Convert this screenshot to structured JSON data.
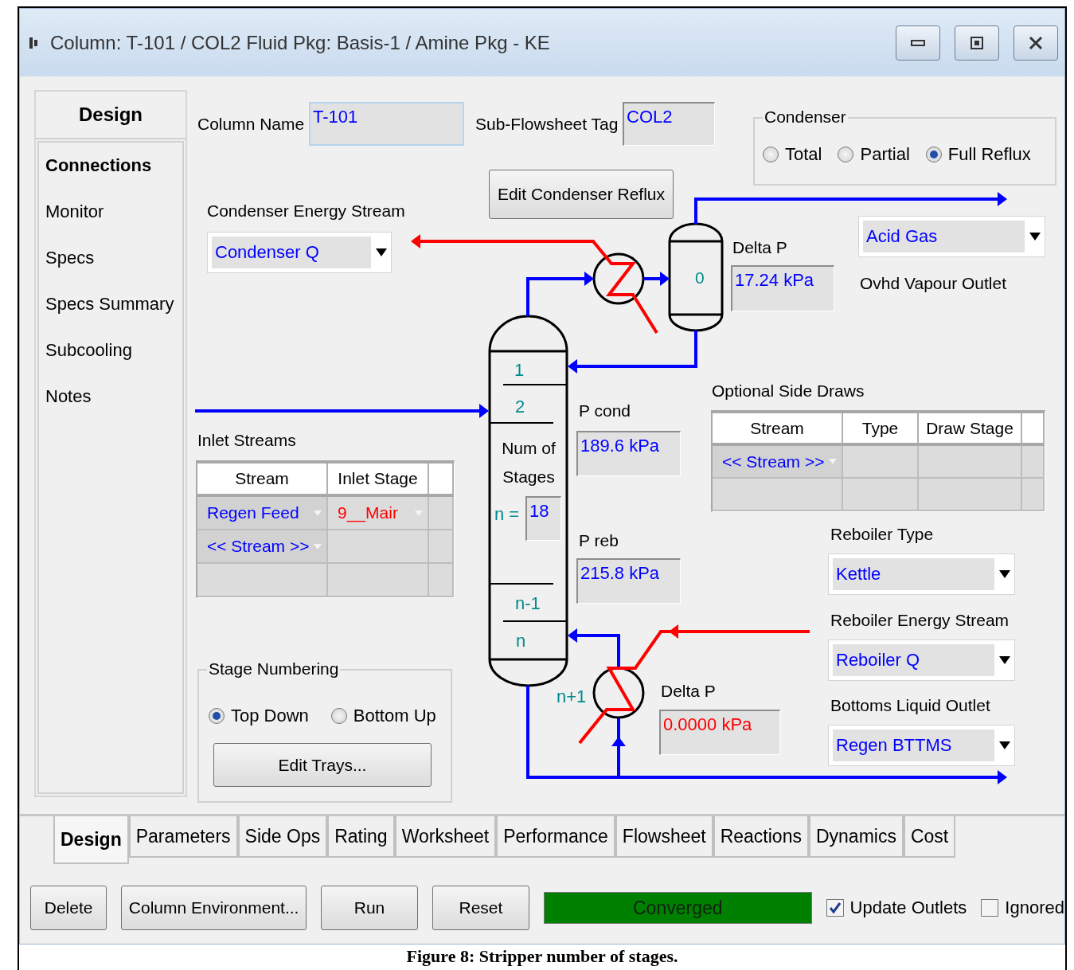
{
  "window": {
    "title": "Column: T-101 / COL2  Fluid Pkg: Basis-1 / Amine Pkg - KE"
  },
  "sidebar": {
    "header": "Design",
    "items": [
      {
        "label": "Connections",
        "selected": true
      },
      {
        "label": "Monitor",
        "selected": false
      },
      {
        "label": "Specs",
        "selected": false
      },
      {
        "label": "Specs Summary",
        "selected": false
      },
      {
        "label": "Subcooling",
        "selected": false
      },
      {
        "label": "Notes",
        "selected": false
      }
    ]
  },
  "design": {
    "column_name": {
      "label": "Column Name",
      "value": "T-101"
    },
    "subflowsheet_tag": {
      "label": "Sub-Flowsheet Tag",
      "value": "COL2"
    },
    "condenser": {
      "title": "Condenser",
      "options": [
        {
          "label": "Total",
          "selected": false
        },
        {
          "label": "Partial",
          "selected": false
        },
        {
          "label": "Full Reflux",
          "selected": true
        }
      ]
    },
    "edit_condenser_button": "Edit Condenser Reflux",
    "condenser_energy_stream": {
      "label": "Condenser Energy Stream",
      "value": "Condenser Q"
    },
    "drum_label": "0",
    "top_delta_p": {
      "label": "Delta P",
      "value": "17.24 kPa",
      "color": "#0000ff"
    },
    "ovhd_vapour_outlet": {
      "label": "Ovhd Vapour Outlet",
      "value": "Acid Gas"
    },
    "column": {
      "stage_labels": [
        "1",
        "2",
        "n-1",
        "n",
        "n+1"
      ],
      "num_stages_label": "Num of Stages",
      "n_label": "n =",
      "n_value": "18"
    },
    "p_cond": {
      "label": "P cond",
      "value": "189.6 kPa",
      "color": "#0000ff"
    },
    "p_reb": {
      "label": "P reb",
      "value": "215.8 kPa",
      "color": "#0000ff"
    },
    "inlet_streams": {
      "title": "Inlet Streams",
      "columns": [
        "Stream",
        "Inlet Stage"
      ],
      "rows": [
        {
          "cells": [
            {
              "text": "Regen Feed",
              "color": "#0000ff"
            },
            {
              "text": "9__Mair",
              "color": "#ff0000"
            }
          ]
        },
        {
          "cells": [
            {
              "text": "<< Stream >>",
              "color": "#0000ff"
            }
          ]
        }
      ]
    },
    "side_draws": {
      "title": "Optional Side Draws",
      "columns": [
        "Stream",
        "Type",
        "Draw Stage"
      ],
      "rows": [
        {
          "cells": [
            {
              "text": "<< Stream >>",
              "color": "#0000ff"
            }
          ]
        }
      ]
    },
    "reboiler_type": {
      "label": "Reboiler Type",
      "value": "Kettle"
    },
    "reboiler_energy_stream": {
      "label": "Reboiler Energy Stream",
      "value": "Reboiler Q"
    },
    "bottoms_liquid_outlet": {
      "label": "Bottoms Liquid Outlet",
      "value": "Regen BTTMS"
    },
    "bottom_delta_p": {
      "label": "Delta P",
      "value": "0.0000 kPa",
      "color": "#ff0000"
    },
    "stage_numbering": {
      "title": "Stage Numbering",
      "options": [
        {
          "label": "Top Down",
          "selected": true
        },
        {
          "label": "Bottom Up",
          "selected": false
        }
      ],
      "button": "Edit Trays..."
    }
  },
  "tabs": [
    {
      "label": "Design",
      "selected": true
    },
    {
      "label": "Parameters",
      "selected": false
    },
    {
      "label": "Side Ops",
      "selected": false
    },
    {
      "label": "Rating",
      "selected": false
    },
    {
      "label": "Worksheet",
      "selected": false
    },
    {
      "label": "Performance",
      "selected": false
    },
    {
      "label": "Flowsheet",
      "selected": false
    },
    {
      "label": "Reactions",
      "selected": false
    },
    {
      "label": "Dynamics",
      "selected": false
    },
    {
      "label": "Cost",
      "selected": false
    }
  ],
  "buttons": [
    "Delete",
    "Column Environment...",
    "Run",
    "Reset"
  ],
  "status": {
    "text": "Converged",
    "color": "#008000"
  },
  "checkboxes": [
    {
      "label": "Update Outlets",
      "checked": true
    },
    {
      "label": "Ignored",
      "checked": false
    }
  ],
  "caption": "Figure 8: Stripper number of stages."
}
